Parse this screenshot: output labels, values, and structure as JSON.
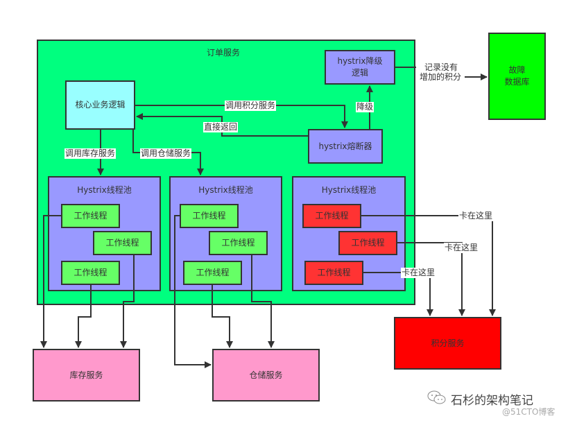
{
  "colors": {
    "order_service": "#00ff7f",
    "core_logic": "#99ffff",
    "hystrix": "#9999ff",
    "worker_ok": "#66ff66",
    "worker_stuck": "#ff3333",
    "downstream": "#ff99cc",
    "points_service": "#ff0000",
    "fault_db": "#00ff00",
    "line": "#333333"
  },
  "order_service": {
    "title": "订单服务"
  },
  "core_logic": {
    "label": "核心业务逻辑"
  },
  "hystrix_fallback": {
    "label_line1": "hystrix降级",
    "label_line2": "逻辑"
  },
  "hystrix_breaker": {
    "label": "hystrix熔断器"
  },
  "fault_db": {
    "label_line1": "故障",
    "label_line2": "数据库"
  },
  "edges": {
    "call_points": "调用积分服务",
    "return_direct": "直接返回",
    "degrade": "降级",
    "record_line1": "记录没有",
    "record_line2": "增加的积分",
    "call_inventory": "调用库存服务",
    "call_warehouse": "调用仓储服务",
    "stuck_here": "卡在这里"
  },
  "pools": [
    {
      "title": "Hystrix线程池",
      "workers": [
        "工作线程",
        "工作线程",
        "工作线程"
      ],
      "state": "ok"
    },
    {
      "title": "Hystrix线程池",
      "workers": [
        "工作线程",
        "工作线程",
        "工作线程"
      ],
      "state": "ok"
    },
    {
      "title": "Hystrix线程池",
      "workers": [
        "工作线程",
        "工作线程",
        "工作线程"
      ],
      "state": "stuck"
    }
  ],
  "services": {
    "inventory": "库存服务",
    "warehouse": "仓储服务",
    "points": "积分服务"
  },
  "watermark": {
    "title": "石杉的架构笔记",
    "source": "@51CTO博客"
  }
}
